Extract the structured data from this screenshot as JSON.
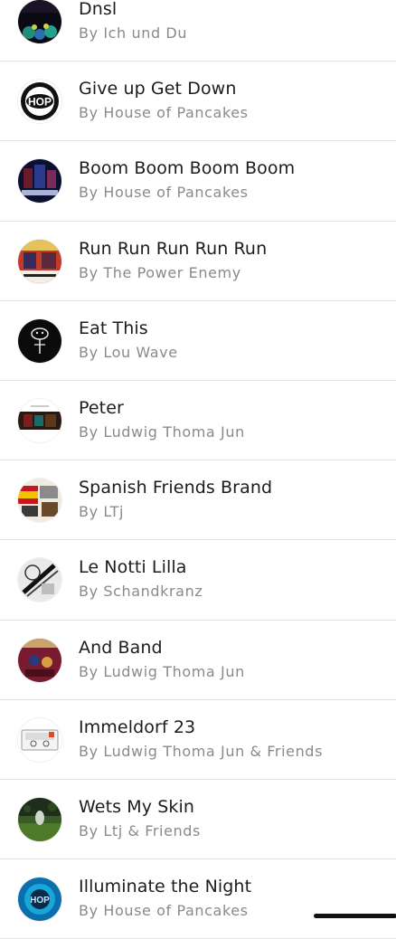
{
  "tracks": [
    {
      "title": "Dnsl",
      "artist": "By Ich und Du",
      "icon": "album-art-ich-und-du"
    },
    {
      "title": "Give up Get Down",
      "artist": "By House of Pancakes",
      "icon": "album-art-hop-logo"
    },
    {
      "title": "Boom Boom Boom Boom",
      "artist": "By House of Pancakes",
      "icon": "album-art-boom"
    },
    {
      "title": "Run Run Run Run Run",
      "artist": "By The Power Enemy",
      "icon": "album-art-power-enemy"
    },
    {
      "title": "Eat This",
      "artist": "By Lou Wave",
      "icon": "album-art-lou-wave"
    },
    {
      "title": "Peter",
      "artist": "By Ludwig Thoma Jun",
      "icon": "album-art-peter"
    },
    {
      "title": "Spanish Friends Brand",
      "artist": "By LTj",
      "icon": "album-art-spanish-friends"
    },
    {
      "title": "Le Notti Lilla",
      "artist": "By Schandkranz",
      "icon": "album-art-schandkranz"
    },
    {
      "title": "And Band",
      "artist": "By Ludwig Thoma Jun",
      "icon": "album-art-and-band"
    },
    {
      "title": "Immeldorf 23",
      "artist": "By Ludwig Thoma Jun & Friends",
      "icon": "album-art-cassette"
    },
    {
      "title": "Wets My Skin",
      "artist": "By Ltj & Friends",
      "icon": "album-art-wets-my-skin"
    },
    {
      "title": "Illuminate the Night",
      "artist": "By House of Pancakes",
      "icon": "album-art-illuminate"
    }
  ]
}
